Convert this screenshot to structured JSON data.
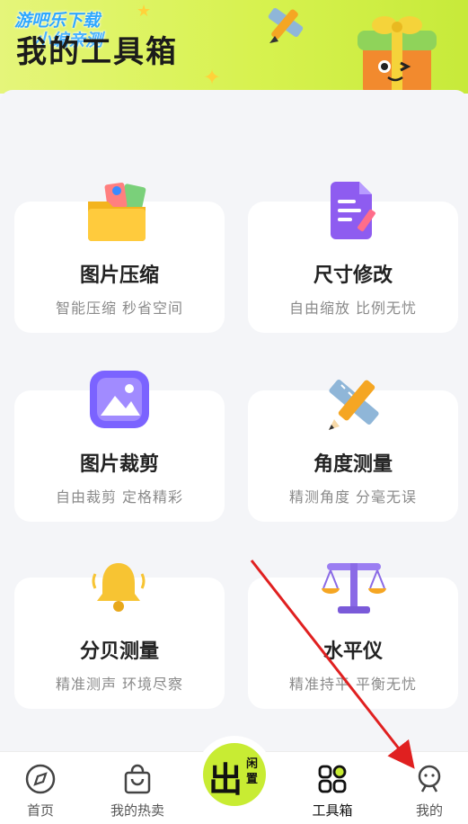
{
  "header": {
    "title": "我的工具箱",
    "watermark_line1": "游吧乐下载",
    "watermark_line2": "小编亲测"
  },
  "tools": [
    {
      "title": "图片压缩",
      "subtitle": "智能压缩 秒省空间",
      "icon": "folder-icon"
    },
    {
      "title": "尺寸修改",
      "subtitle": "自由缩放 比例无忧",
      "icon": "document-edit-icon"
    },
    {
      "title": "图片裁剪",
      "subtitle": "自由裁剪 定格精彩",
      "icon": "image-icon"
    },
    {
      "title": "角度测量",
      "subtitle": "精测角度 分毫无误",
      "icon": "ruler-pencil-icon"
    },
    {
      "title": "分贝测量",
      "subtitle": "精准测声 环境尽察",
      "icon": "bell-icon"
    },
    {
      "title": "水平仪",
      "subtitle": "精准持平 平衡无忧",
      "icon": "balance-scale-icon"
    }
  ],
  "tabbar": {
    "items": [
      {
        "label": "首页",
        "icon": "compass-icon"
      },
      {
        "label": "我的热卖",
        "icon": "shopping-bag-icon"
      },
      {
        "label": "工具箱",
        "icon": "grid-icon",
        "active": true
      },
      {
        "label": "我的",
        "icon": "profile-icon"
      }
    ],
    "center": {
      "big": "出",
      "small": "闲置"
    }
  },
  "colors": {
    "header_green": "#d7f24f",
    "accent_green": "#c8ec33",
    "arrow_red": "#e02020"
  }
}
